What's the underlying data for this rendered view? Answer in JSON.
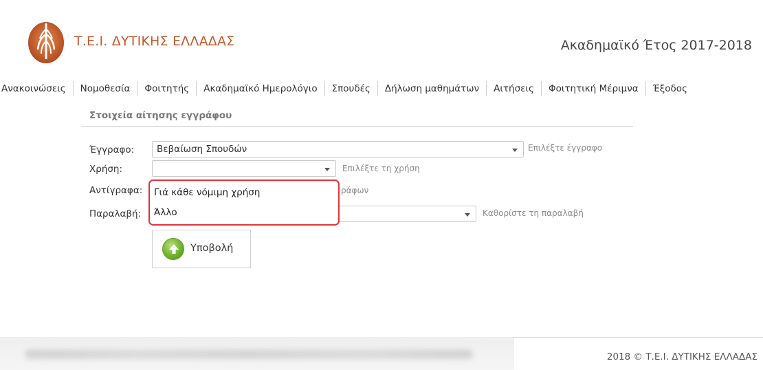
{
  "header": {
    "site_title": "Τ.Ε.Ι. ΔΥΤΙΚΗΣ ΕΛΛΑΔΑΣ",
    "academic_year": "Ακαδημαϊκό Έτος 2017-2018",
    "logo_icon": "tei-logo-icon"
  },
  "nav": {
    "items": [
      {
        "label": "Ανακοινώσεις"
      },
      {
        "label": "Νομοθεσία"
      },
      {
        "label": "Φοιτητής"
      },
      {
        "label": "Ακαδημαϊκό Ημερολόγιο"
      },
      {
        "label": "Σπουδές"
      },
      {
        "label": "Δήλωση μαθημάτων"
      },
      {
        "label": "Αιτήσεις"
      },
      {
        "label": "Φοιτητική Μέριμνα"
      },
      {
        "label": "Έξοδος"
      }
    ]
  },
  "form": {
    "section_title": "Στοιχεία αίτησης εγγράφου",
    "document": {
      "label": "Έγγραφο:",
      "value": "Βεβαίωση Σπουδών",
      "hint": "Επιλέξτε έγγραφο"
    },
    "usage": {
      "label": "Χρήση:",
      "value": "",
      "hint": "Επιλέξτε τη χρήση"
    },
    "copies": {
      "label": "Αντίγραφα:",
      "hint_partial": "ράφων"
    },
    "delivery": {
      "label": "Παραλαβή:",
      "value": "",
      "hint": "Καθορίστε τη παραλαβή"
    },
    "usage_options": [
      "Γιά κάθε νόμιμη χρήση",
      "Άλλο"
    ],
    "submit_label": "Υποβολή"
  },
  "footer": {
    "copyright": "2018 © Τ.Ε.Ι. ΔΥΤΙΚΗΣ ΕΛΛΑΔΑΣ"
  },
  "colors": {
    "brand": "#c25a2e",
    "highlight_border": "#e1333a",
    "submit_green": "#6fb22f"
  }
}
